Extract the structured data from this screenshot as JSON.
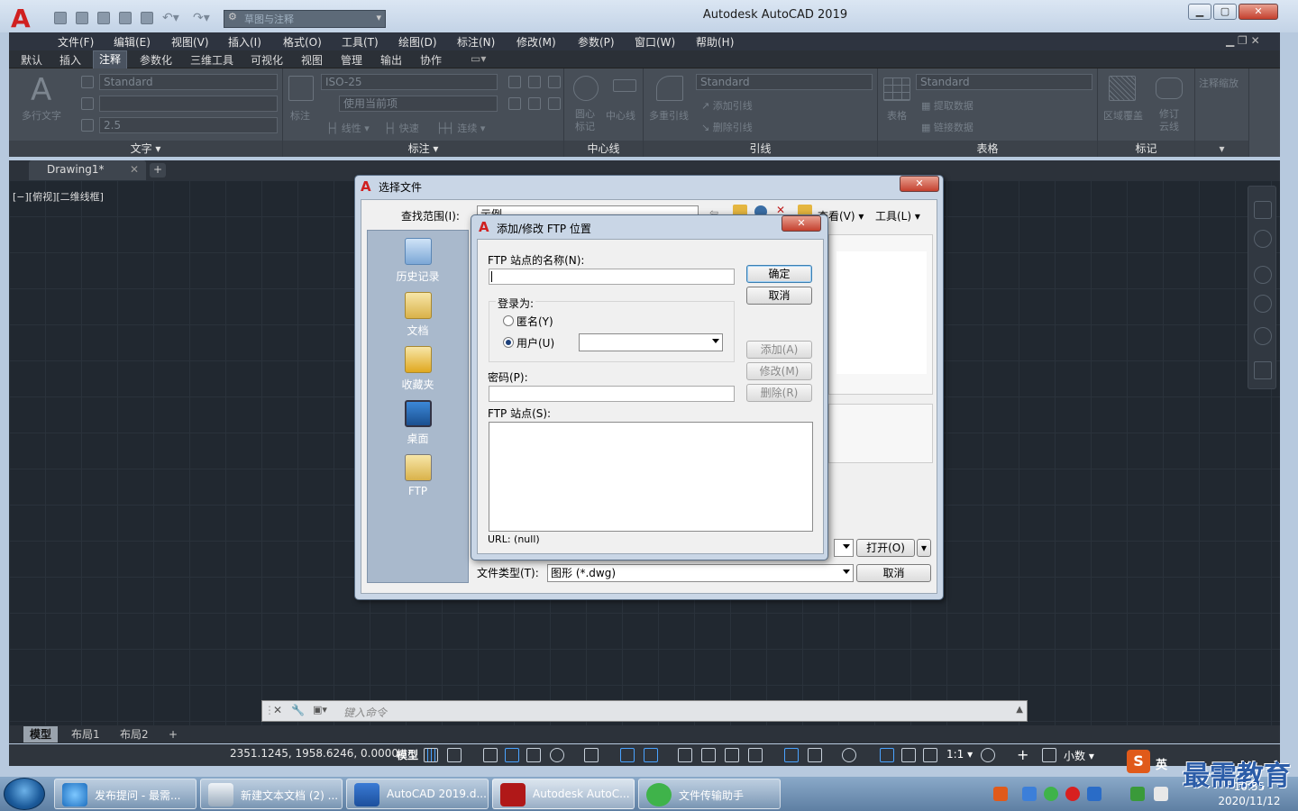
{
  "app": {
    "title": "Autodesk AutoCAD 2019",
    "workspace": "草图与注释",
    "menus": [
      "文件(F)",
      "编辑(E)",
      "视图(V)",
      "插入(I)",
      "格式(O)",
      "工具(T)",
      "绘图(D)",
      "标注(N)",
      "修改(M)",
      "参数(P)",
      "窗口(W)",
      "帮助(H)"
    ],
    "ribbon_tabs": [
      "默认",
      "插入",
      "注释",
      "参数化",
      "三维工具",
      "可视化",
      "视图",
      "管理",
      "输出",
      "协作"
    ],
    "active_ribbon_tab": "注释"
  },
  "ribbon": {
    "text_panel": {
      "label": "文字 ▾",
      "big_button": "多行文字",
      "style": "Standard",
      "height": "2.5"
    },
    "dim_panel": {
      "label": "标注 ▾",
      "big_button": "标注",
      "style": "ISO-25",
      "layer": "使用当前项",
      "linear": "线性",
      "quick": "快速",
      "continue": "连续"
    },
    "center_panel": {
      "label": "中心线",
      "center_mark": "圆心\n标记",
      "centerline": "中心线"
    },
    "leader_panel": {
      "label": "引线",
      "big_button": "多重引线",
      "style": "Standard",
      "add": "添加引线",
      "remove": "删除引线"
    },
    "table_panel": {
      "label": "表格",
      "big_button": "表格",
      "style": "Standard",
      "extract": "提取数据",
      "link": "链接数据"
    },
    "markup_panel": {
      "label": "标记",
      "wipeout": "区域覆盖",
      "revcloud": "修订\n云线"
    },
    "scale_panel": {
      "label": "注释缩放"
    }
  },
  "document": {
    "tab": "Drawing1*",
    "viewport_label": "[−][俯视][二维线框]"
  },
  "layout_tabs": [
    "模型",
    "布局1",
    "布局2"
  ],
  "command_placeholder": "键入命令",
  "status": {
    "coords": "2351.1245, 1958.6246, 0.0000",
    "model": "模型",
    "scale": "1:1",
    "units": "小数"
  },
  "select_file_dialog": {
    "title": "选择文件",
    "lookin_label": "查找范围(I):",
    "lookin_value": "示例",
    "views": "查看(V)",
    "tools": "工具(L)",
    "places": [
      "历史记录",
      "文档",
      "收藏夹",
      "桌面",
      "FTP"
    ],
    "open_button": "打开(O)",
    "filetype_label": "文件类型(T):",
    "filetype_value": "图形 (*.dwg)",
    "cancel_button": "取消"
  },
  "ftp_dialog": {
    "title": "添加/修改 FTP 位置",
    "site_name_label": "FTP 站点的名称(N):",
    "site_name_value": "",
    "login_label": "登录为:",
    "anonymous_label": "匿名(Y)",
    "user_label": "用户(U)",
    "user_value": "",
    "password_label": "密码(P):",
    "password_value": "",
    "sites_label": "FTP 站点(S):",
    "url_text": "URL: (null)",
    "ok": "确定",
    "cancel": "取消",
    "add": "添加(A)",
    "modify": "修改(M)",
    "delete": "删除(R)"
  },
  "taskbar": {
    "items": [
      "发布提问 - 最需...",
      "新建文本文档 (2) ...",
      "AutoCAD 2019.d...",
      "Autodesk AutoC...",
      "文件传输助手"
    ],
    "ime": "英",
    "time": "10:55",
    "date": "2020/11/12"
  },
  "watermark": "最需教育",
  "colors": {
    "accent": "#d02020",
    "canvas": "#212830",
    "ribbon": "#474e57"
  }
}
